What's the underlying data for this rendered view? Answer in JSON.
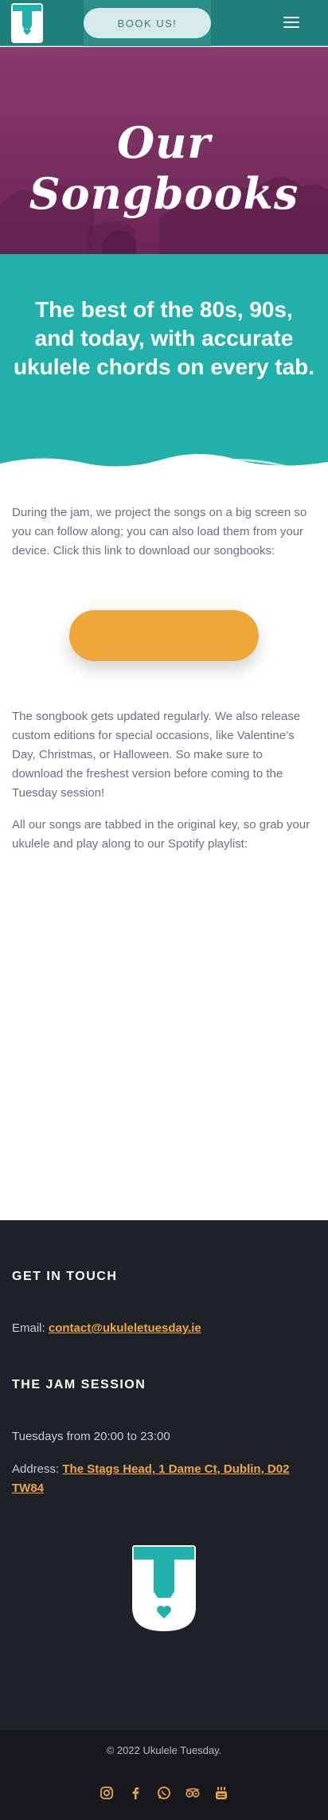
{
  "header": {
    "book_label": "BOOK US!",
    "logo_icon": "ukulele-logo-icon",
    "menu_icon": "hamburger-menu-icon",
    "bg_color": "#1f7f7a"
  },
  "hero": {
    "title": "Our Songbooks"
  },
  "intro": {
    "heading": "The best of the 80s, 90s, and today, with accurate ukulele chords on every tab."
  },
  "content": {
    "para1": "During the jam, we project the songs on a big screen so you can follow along; you can also load them from your device. Click this link to download our songbooks:",
    "para2": "The songbook gets updated regularly. We also release custom editions for  special occasions, like Valentine’s Day, Christmas, or Halloween. So make sure to download the freshest version before coming to the Tuesday session!",
    "para3": "All our songs are tabbed in the original key, so grab your ukulele and play along to our Spotify playlist:",
    "download_button_color": "#f0a73a"
  },
  "footer": {
    "contact_heading": "GET IN TOUCH",
    "email_label": "Email:",
    "email": "contact@ukuleletuesday.ie",
    "jam_heading": "THE JAM SESSION",
    "schedule": "Tuesdays from 20:00 to 23:00",
    "address_label": "Address:",
    "address": "The Stags Head, 1 Dame Ct, Dublin, D02 TW84",
    "copyright": "© 2022 Ukulele Tuesday.",
    "accent_color": "#f0a73a",
    "social_icons": [
      "instagram-icon",
      "facebook-icon",
      "whatsapp-icon",
      "tripadvisor-icon",
      "youtube-icon"
    ]
  }
}
